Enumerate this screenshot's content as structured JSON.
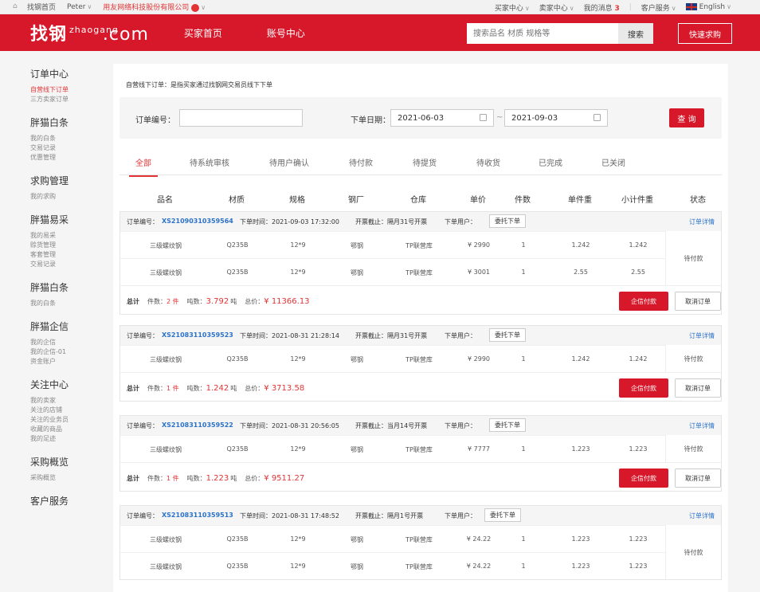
{
  "topbar": {
    "home": "找钢首页",
    "user": "Peter",
    "company": "用友网络科技股份有限公司",
    "buyer_center": "买家中心",
    "seller_center": "卖家中心",
    "messages": "我的消息",
    "messages_count": "3",
    "service": "客户服务",
    "language": "English"
  },
  "header": {
    "logo": "找钢",
    "logo_sub": "zhaogang",
    "logo_com": ".com",
    "nav": [
      "买家首页",
      "账号中心"
    ],
    "search_placeholder": "搜索品名 材质 规格等",
    "search_button": "搜索",
    "quick_button": "快速求购"
  },
  "sidebar": [
    {
      "title": "订单中心",
      "items": [
        "自营线下订单",
        "三方卖家订单"
      ],
      "active": 0
    },
    {
      "title": "胖猫白条",
      "items": [
        "我的白条",
        "交易记录",
        "优惠管理"
      ]
    },
    {
      "title": "求购管理",
      "items": [
        "我的求购"
      ]
    },
    {
      "title": "胖猫易采",
      "items": [
        "我的易采",
        "赊货管理",
        "客套管理",
        "交易记录"
      ]
    },
    {
      "title": "胖猫白条",
      "items": [
        "我的白条"
      ]
    },
    {
      "title": "胖猫企信",
      "items": [
        "我的企信",
        "我的企信-01",
        "资金账户"
      ]
    },
    {
      "title": "关注中心",
      "items": [
        "我的卖家",
        "关注的店铺",
        "关注的业务员",
        "收藏的商品",
        "我的足迹"
      ]
    },
    {
      "title": "采购概览",
      "items": [
        "采购概览"
      ]
    },
    {
      "title": "客户服务",
      "items": []
    }
  ],
  "main": {
    "note": "自营线下订单：是指买家通过找钢网交易员线下下单",
    "filter": {
      "order_no_label": "订单编号：",
      "order_no_value": "",
      "date_label": "下单日期：",
      "date_from": "2021-06-03",
      "date_sep": "~",
      "date_to": "2021-09-03",
      "query_button": "查 询"
    },
    "tabs": [
      "全部",
      "待系统审核",
      "待用户确认",
      "待付款",
      "待提货",
      "待收货",
      "已完成",
      "已关闭"
    ],
    "columns": [
      "品名",
      "材质",
      "规格",
      "钢厂",
      "仓库",
      "单价",
      "件数",
      "单件重",
      "小计件重",
      "状态"
    ],
    "orders": [
      {
        "label": "订单编号：",
        "no": "XS21090310359564",
        "time": "下单时间：2021-09-03 17:32:00",
        "invoice": "开票截止：隔月31号开票",
        "user": "下单用户：",
        "entrust": "委托下单",
        "detail": "订单详情",
        "rows": [
          [
            "三级螺纹钢",
            "Q235B",
            "12*9",
            "鄂钢",
            "TP联营库",
            "¥ 2990",
            "1",
            "1.242",
            "1.242"
          ],
          [
            "三级螺纹钢",
            "Q235B",
            "12*9",
            "鄂钢",
            "TP联营库",
            "¥ 3001",
            "1",
            "2.55",
            "2.55"
          ]
        ],
        "status": "待付款",
        "total": "总计",
        "count_label": "件数：",
        "count": "2 件",
        "weight_label": "吨数：",
        "weight": "3.792",
        "weight_unit": "吨",
        "price_label": "总价：",
        "price": "¥ 11366.13",
        "pay": "企信付款",
        "cancel": "取消订单"
      },
      {
        "label": "订单编号：",
        "no": "XS21083110359523",
        "time": "下单时间：2021-08-31 21:28:14",
        "invoice": "开票截止：隔月31号开票",
        "user": "下单用户：",
        "entrust": "委托下单",
        "detail": "订单详情",
        "rows": [
          [
            "三级螺纹钢",
            "Q235B",
            "12*9",
            "鄂钢",
            "TP联营库",
            "¥ 2990",
            "1",
            "1.242",
            "1.242"
          ]
        ],
        "status": "待付款",
        "total": "总计",
        "count_label": "件数：",
        "count": "1 件",
        "weight_label": "吨数：",
        "weight": "1.242",
        "weight_unit": "吨",
        "price_label": "总价：",
        "price": "¥ 3713.58",
        "pay": "企信付款",
        "cancel": "取消订单"
      },
      {
        "label": "订单编号：",
        "no": "XS21083110359522",
        "time": "下单时间：2021-08-31 20:56:05",
        "invoice": "开票截止：当月14号开票",
        "user": "下单用户：",
        "entrust": "委托下单",
        "detail": "订单详情",
        "rows": [
          [
            "三级螺纹钢",
            "Q235B",
            "12*9",
            "鄂钢",
            "TP联营库",
            "¥ 7777",
            "1",
            "1.223",
            "1.223"
          ]
        ],
        "status": "待付款",
        "total": "总计",
        "count_label": "件数：",
        "count": "1 件",
        "weight_label": "吨数：",
        "weight": "1.223",
        "weight_unit": "吨",
        "price_label": "总价：",
        "price": "¥ 9511.27",
        "pay": "企信付款",
        "cancel": "取消订单"
      },
      {
        "label": "订单编号：",
        "no": "XS21083110359513",
        "time": "下单时间：2021-08-31 17:48:52",
        "invoice": "开票截止：隔月1号开票",
        "user": "下单用户：",
        "entrust": "委托下单",
        "detail": "订单详情",
        "rows": [
          [
            "三级螺纹钢",
            "Q235B",
            "12*9",
            "鄂钢",
            "TP联营库",
            "¥ 24.22",
            "1",
            "1.223",
            "1.223"
          ],
          [
            "三级螺纹钢",
            "Q235B",
            "12*9",
            "鄂钢",
            "TP联营库",
            "¥ 24.22",
            "1",
            "1.223",
            "1.223"
          ]
        ],
        "status": "待付款"
      }
    ]
  }
}
